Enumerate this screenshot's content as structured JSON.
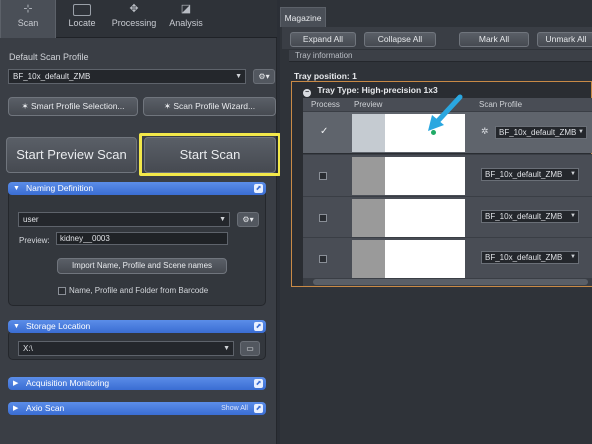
{
  "left_tabs": [
    {
      "label": "Scan",
      "icon": "scan-icon"
    },
    {
      "label": "Locate",
      "icon": "locate-icon"
    },
    {
      "label": "Processing",
      "icon": "processing-icon"
    },
    {
      "label": "Analysis",
      "icon": "analysis-icon"
    }
  ],
  "default_scan_profile": {
    "label": "Default Scan Profile",
    "value": "BF_10x_default_ZMB",
    "smart_profile_button": "Smart Profile Selection...",
    "wizard_button": "Scan Profile Wizard..."
  },
  "actions": {
    "start_preview": "Start Preview Scan",
    "start_scan": "Start Scan"
  },
  "naming": {
    "title": "Naming Definition",
    "user_value": "user",
    "preview_label": "Preview:",
    "preview_value": "kidney__0003",
    "import_button": "Import Name, Profile and Scene names",
    "barcode_label": "Name, Profile and Folder from Barcode"
  },
  "storage": {
    "title": "Storage Location",
    "path": "X:\\"
  },
  "acquisition": {
    "title": "Acquisition Monitoring"
  },
  "axio": {
    "title": "Axio Scan",
    "show_all": "Show All"
  },
  "magazine": {
    "tab": "Magazine",
    "buttons": {
      "expand": "Expand All",
      "collapse": "Collapse All",
      "mark": "Mark All",
      "unmark": "Unmark All"
    },
    "tray_info": "Tray information",
    "tray_position_label": "Tray position:",
    "tray_position_value": "1",
    "tray_type_label": "Tray Type:",
    "tray_type_value": "High-precision 1x3",
    "columns": [
      "Process",
      "Preview",
      "Scan Profile"
    ],
    "rows": [
      {
        "checked": true,
        "profile": "BF_10x_default_ZMB"
      },
      {
        "checked": false,
        "profile": "BF_10x_default_ZMB"
      },
      {
        "checked": false,
        "profile": "BF_10x_default_ZMB"
      },
      {
        "checked": false,
        "profile": "BF_10x_default_ZMB"
      }
    ]
  },
  "colors": {
    "highlight": "#f3e84a",
    "header_blue": "#3a6dd3",
    "arrow": "#2aa7e0"
  }
}
